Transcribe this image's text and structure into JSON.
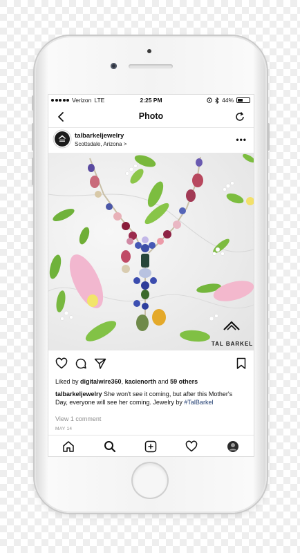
{
  "status_bar": {
    "carrier": "Verizon",
    "network": "LTE",
    "time": "2:25 PM",
    "battery": "44%",
    "battery_level": 0.44
  },
  "nav": {
    "title": "Photo",
    "back_icon": "chevron-left-icon",
    "refresh_icon": "refresh-icon"
  },
  "post": {
    "username": "talbarkeljewelry",
    "location": "Scottsdale, Arizona >",
    "more_icon": "more-horizontal-icon",
    "brand_logo_text": "TAL BARKEL",
    "likes_prefix": "Liked by ",
    "liker_1": "digitalwire360",
    "likes_sep": ", ",
    "liker_2": "kacienorth",
    "likes_and": " and ",
    "likes_count": "59 others",
    "caption_user": "talbarkeljewelry",
    "caption_text": " She won't see it coming, but after this Mother's Day, everyone will see her coming. Jewelry by ",
    "caption_tag": "#TalBarkel",
    "view_comments": "View 1 comment",
    "date": "MAY 14"
  },
  "actions": [
    "heart-icon",
    "comment-icon",
    "share-icon",
    "bookmark-icon"
  ],
  "tab_bar": [
    "home-icon",
    "search-icon",
    "add-post-icon",
    "activity-heart-icon",
    "profile-avatar-icon"
  ]
}
